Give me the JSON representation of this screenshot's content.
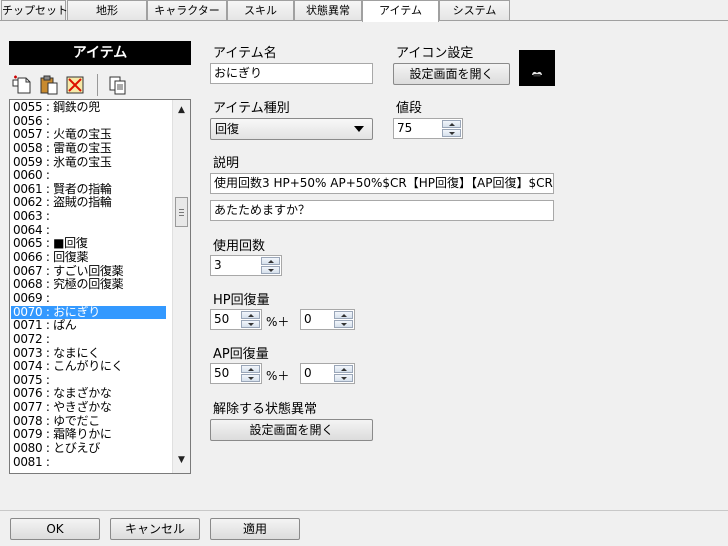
{
  "tabs": [
    {
      "label": "チップセット"
    },
    {
      "label": "地形"
    },
    {
      "label": "キャラクター"
    },
    {
      "label": "スキル"
    },
    {
      "label": "状態異常"
    },
    {
      "label": "アイテム"
    },
    {
      "label": "システム"
    }
  ],
  "list": {
    "title": "アイテム",
    "items": [
      "0055 : 鋼鉄の兜",
      "0056 :",
      "0057 : 火竜の宝玉",
      "0058 : 雷竜の宝玉",
      "0059 : 氷竜の宝玉",
      "0060 :",
      "0061 : 賢者の指輪",
      "0062 : 盗賊の指輪",
      "0063 :",
      "0064 :",
      "0065 : ■回復",
      "0066 : 回復薬",
      "0067 : すごい回復薬",
      "0068 : 究極の回復薬",
      "0069 :",
      "0070 : おにぎり",
      "0071 : ぱん",
      "0072 :",
      "0073 : なまにく",
      "0074 : こんがりにく",
      "0075 :",
      "0076 : なまざかな",
      "0077 : やきざかな",
      "0078 : ゆでだこ",
      "0079 : 霜降りかに",
      "0080 : とびえび",
      "0081 :"
    ],
    "selected_index": 15
  },
  "form": {
    "item_name_label": "アイテム名",
    "item_name_value": "おにぎり",
    "icon_settings_label": "アイコン設定",
    "open_settings_label": "設定画面を開く",
    "item_type_label": "アイテム種別",
    "item_type_value": "回復",
    "price_label": "値段",
    "price_value": "75",
    "description_label": "説明",
    "description_line1": "使用回数3 HP+50% AP+50%$CR【HP回復】【AP回復】$CR",
    "description_line2": "あたためますか？",
    "uses_label": "使用回数",
    "uses_value": "3",
    "hp_label": "HP回復量",
    "hp_percent": "50",
    "hp_flat": "0",
    "ap_label": "AP回復量",
    "ap_percent": "50",
    "ap_flat": "0",
    "percent_plus": "%＋",
    "cure_status_label": "解除する状態異常",
    "cure_status_button": "設定画面を開く"
  },
  "footer": {
    "ok": "OK",
    "cancel": "キャンセル",
    "apply": "適用"
  },
  "icons": [
    "new-file-icon",
    "paste-icon",
    "delete-icon",
    "copy-icon"
  ]
}
